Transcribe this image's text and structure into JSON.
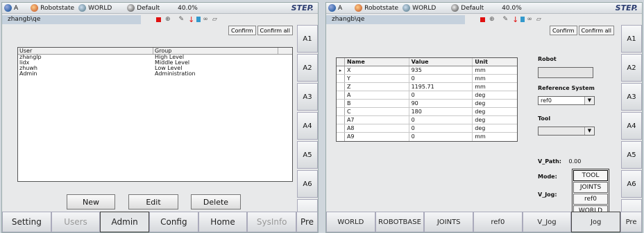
{
  "status": {
    "a": "A",
    "robotstate": "Robotstate",
    "world": "WORLD",
    "default": "Default",
    "percent": "40.0%",
    "step": "STEP."
  },
  "path": "zhangb\\qe",
  "confirm": "Confirm",
  "confirm_all": "Confirm all",
  "side_buttons": [
    "A1",
    "A2",
    "A3",
    "A4",
    "A5",
    "A6"
  ],
  "screen1": {
    "columns": [
      "User",
      "Group"
    ],
    "users": [
      {
        "user": "zhanglp",
        "group": "High Level"
      },
      {
        "user": "lidx",
        "group": "Middle Level"
      },
      {
        "user": "zhuwh",
        "group": "Low Level"
      },
      {
        "user": "Admin",
        "group": "Administration"
      }
    ],
    "actions": {
      "new": "New",
      "edit": "Edit",
      "delete": "Delete"
    },
    "tabs": [
      "Setting",
      "Users",
      "Admin",
      "Config",
      "Home",
      "SysInfo",
      "Pre"
    ]
  },
  "screen2": {
    "columns": [
      "Name",
      "Value",
      "Unit"
    ],
    "rows": [
      {
        "name": "X",
        "value": "935",
        "unit": "mm"
      },
      {
        "name": "Y",
        "value": "0",
        "unit": "mm"
      },
      {
        "name": "Z",
        "value": "1195.71",
        "unit": "mm"
      },
      {
        "name": "A",
        "value": "0",
        "unit": "deg"
      },
      {
        "name": "B",
        "value": "90",
        "unit": "deg"
      },
      {
        "name": "C",
        "value": "180",
        "unit": "deg"
      },
      {
        "name": "A7",
        "value": "0",
        "unit": "deg"
      },
      {
        "name": "A8",
        "value": "0",
        "unit": "deg"
      },
      {
        "name": "A9",
        "value": "0",
        "unit": "mm"
      }
    ],
    "robot_label": "Robot",
    "reference_label": "Reference System",
    "reference_value": "ref0",
    "tool_label": "Tool",
    "vpath_label": "V_Path:",
    "vpath_value": "0.00",
    "mode_label": "Mode:",
    "vjog_label": "V_Jog:",
    "mode_options": [
      "TOOL",
      "JOINTS",
      "ref0",
      "WORLD"
    ],
    "tabs": [
      "WORLD",
      "ROBOTBASE",
      "JOINTS",
      "ref0",
      "V_Jog",
      "Jog",
      "Pre"
    ]
  }
}
